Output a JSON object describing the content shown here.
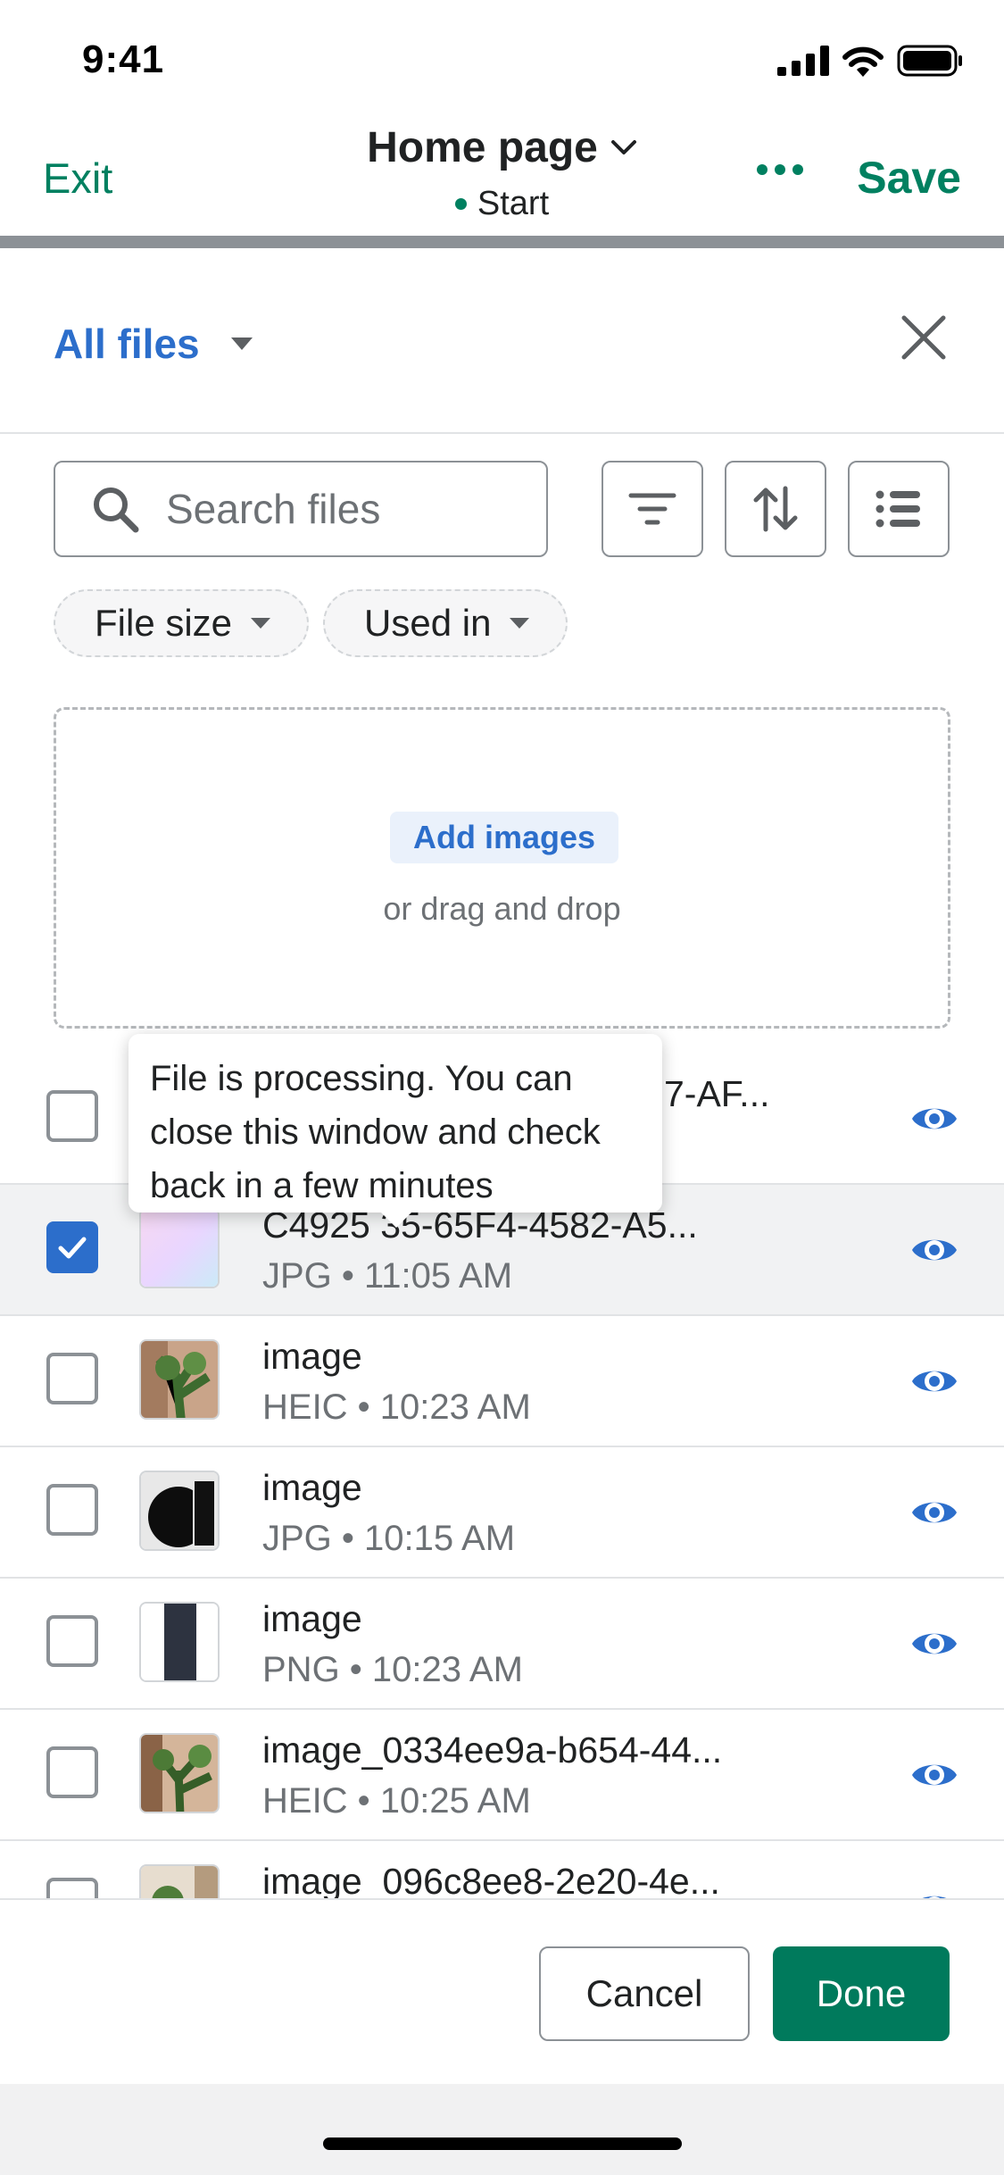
{
  "status_bar": {
    "time": "9:41"
  },
  "header": {
    "exit_label": "Exit",
    "title": "Home page",
    "status": "Start",
    "save_label": "Save"
  },
  "modal": {
    "scope_label": "All files",
    "search_placeholder": "Search files",
    "chips": [
      {
        "label": "File size"
      },
      {
        "label": "Used in"
      }
    ],
    "dropzone": {
      "add_label": "Add images",
      "hint": "or drag and drop"
    },
    "tooltip": "File is processing. You can close this window and check back in a few minutes",
    "files": [
      {
        "name": "7-AF...",
        "meta": "",
        "checked": false
      },
      {
        "name": "C4925  35-65F4-4582-A5...",
        "meta": "JPG • 11:05 AM",
        "checked": true
      },
      {
        "name": "image",
        "meta": "HEIC • 10:23 AM",
        "checked": false
      },
      {
        "name": "image",
        "meta": "JPG • 10:15 AM",
        "checked": false
      },
      {
        "name": "image",
        "meta": "PNG • 10:23 AM",
        "checked": false
      },
      {
        "name": "image_0334ee9a-b654-44...",
        "meta": "HEIC • 10:25 AM",
        "checked": false
      },
      {
        "name": "image_096c8ee8-2e20-4e...",
        "meta": "",
        "checked": false
      }
    ],
    "cancel_label": "Cancel",
    "done_label": "Done"
  },
  "colors": {
    "accent_green": "#008060",
    "link_blue": "#2c6ecb",
    "primary_button": "#007a5c"
  },
  "icons": [
    "signal-icon",
    "wifi-icon",
    "battery-icon",
    "chevron-down-icon",
    "more-icon",
    "caret-down-icon",
    "close-icon",
    "search-icon",
    "filter-icon",
    "sort-icon",
    "list-view-icon",
    "checkmark-icon",
    "eye-icon"
  ]
}
